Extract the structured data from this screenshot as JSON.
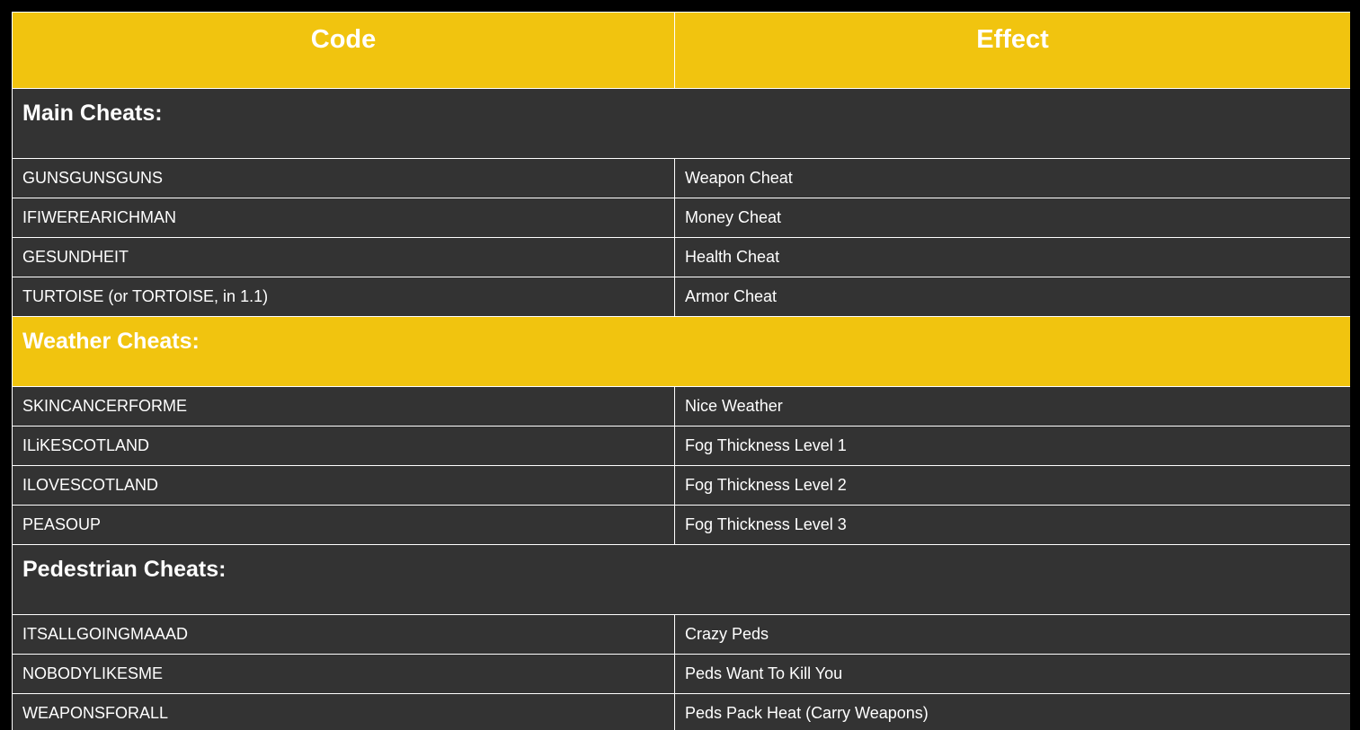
{
  "table": {
    "headers": [
      "Code",
      "Effect"
    ],
    "sections": [
      {
        "title": "Main Cheats:",
        "style": "dark",
        "rows": [
          {
            "code": "GUNSGUNSGUNS",
            "effect": "Weapon Cheat"
          },
          {
            "code": "IFIWEREARICHMAN",
            "effect": "Money Cheat"
          },
          {
            "code": "GESUNDHEIT",
            "effect": "Health Cheat"
          },
          {
            "code": "TURTOISE (or TORTOISE, in 1.1)",
            "effect": "Armor Cheat"
          }
        ]
      },
      {
        "title": "Weather Cheats:",
        "style": "yellow",
        "rows": [
          {
            "code": "SKINCANCERFORME",
            "effect": "Nice Weather"
          },
          {
            "code": "ILiKESCOTLAND",
            "effect": "Fog Thickness Level 1"
          },
          {
            "code": "ILOVESCOTLAND",
            "effect": "Fog Thickness Level 2"
          },
          {
            "code": "PEASOUP",
            "effect": "Fog Thickness Level 3"
          }
        ]
      },
      {
        "title": "Pedestrian Cheats:",
        "style": "dark",
        "rows": [
          {
            "code": "ITSALLGOINGMAAAD",
            "effect": "Crazy Peds"
          },
          {
            "code": "NOBODYLIKESME",
            "effect": "Peds Want To Kill You"
          },
          {
            "code": "WEAPONSFORALL",
            "effect": "Peds Pack Heat (Carry Weapons)"
          }
        ]
      }
    ]
  },
  "colors": {
    "accent": "#f1c40f",
    "row_background": "#333333",
    "text": "#ffffff",
    "page_background": "#000000"
  }
}
